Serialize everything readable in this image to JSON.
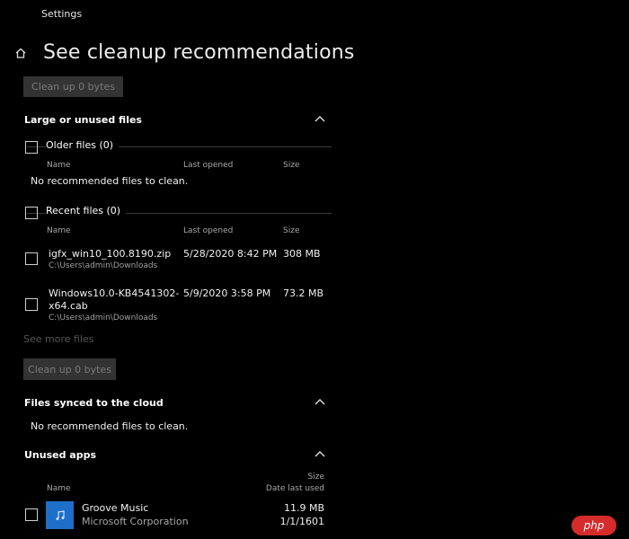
{
  "window": {
    "title": "Settings"
  },
  "page": {
    "title": "See cleanup recommendations"
  },
  "top_button": {
    "label": "Clean up 0 bytes"
  },
  "large_unused": {
    "title": "Large or unused files",
    "older": {
      "label": "Older files (0)",
      "columns": {
        "name": "Name",
        "last_opened": "Last opened",
        "size": "Size"
      },
      "empty_text": "No recommended files to clean."
    },
    "recent": {
      "label": "Recent files (0)",
      "columns": {
        "name": "Name",
        "last_opened": "Last opened",
        "size": "Size"
      },
      "files": [
        {
          "name": "igfx_win10_100.8190.zip",
          "name_line2": "",
          "path": "C:\\Users\\admin\\Downloads",
          "last_opened": "5/28/2020 8:42 PM",
          "size": "308 MB"
        },
        {
          "name": "Windows10.0-KB4541302-",
          "name_line2": "x64.cab",
          "path": "C:\\Users\\admin\\Downloads",
          "last_opened": "5/9/2020 3:58 PM",
          "size": "73.2 MB"
        }
      ]
    },
    "see_more": "See more files",
    "button_label": "Clean up 0 bytes"
  },
  "cloud": {
    "title": "Files synced to the cloud",
    "empty_text": "No recommended files to clean."
  },
  "unused_apps": {
    "title": "Unused apps",
    "columns": {
      "name": "Name",
      "size": "Size",
      "date_last_used": "Date last used"
    },
    "apps": [
      {
        "name": "Groove Music",
        "publisher": "Microsoft Corporation",
        "size": "11.9 MB",
        "date_last_used": "1/1/1601"
      }
    ]
  },
  "watermark": {
    "text": "php"
  },
  "colors": {
    "background": "#000000",
    "button_bg": "#333333",
    "app_icon": "#1e6fc8",
    "watermark": "#d62b2b"
  }
}
